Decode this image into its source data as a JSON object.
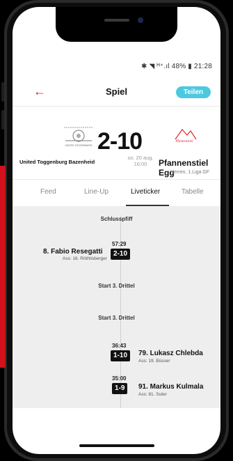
{
  "status_bar": {
    "text": "✱ ◥ ᴴ⁺.ıl 48% ▮ 21:28"
  },
  "app_bar": {
    "back_icon": "arrow-left-icon",
    "title": "Spiel",
    "share_label": "Teilen",
    "accent": "#e3242b",
    "share_color": "#4bc9e0"
  },
  "match": {
    "home_team": "United Toggenburg Bazenheid",
    "away_team": "Pfannenstiel Egg",
    "score": "2-10",
    "date": "so. 20 aug.",
    "time": "16:00",
    "league": "Herren, 1.Liga GF",
    "home_logo_caption": "UNITED TOGGENBURG",
    "away_logo_caption": "Pfannenstiel"
  },
  "tabs": [
    {
      "label": "Feed",
      "active": false
    },
    {
      "label": "Line-Up",
      "active": false
    },
    {
      "label": "Liveticker",
      "active": true
    },
    {
      "label": "Tabelle",
      "active": false
    }
  ],
  "ticker": {
    "final_whistle": "Schlusspfiff",
    "event1": {
      "time": "57:29",
      "score": "2-10",
      "player": "8. Fabio Resegatti",
      "assist": "Ass: 16. Röthlisberger"
    },
    "period_start_1": "Start 3. Drittel",
    "period_start_2": "Start 3. Drittel",
    "event2": {
      "time": "36:43",
      "score": "1-10",
      "player": "79. Lukasz Chlebda",
      "assist": "Ass: 19. Büsser"
    },
    "event3": {
      "time": "35:00",
      "score": "1-9",
      "player": "91. Markus Kulmala",
      "assist": "Ass: 81. Suter"
    }
  }
}
